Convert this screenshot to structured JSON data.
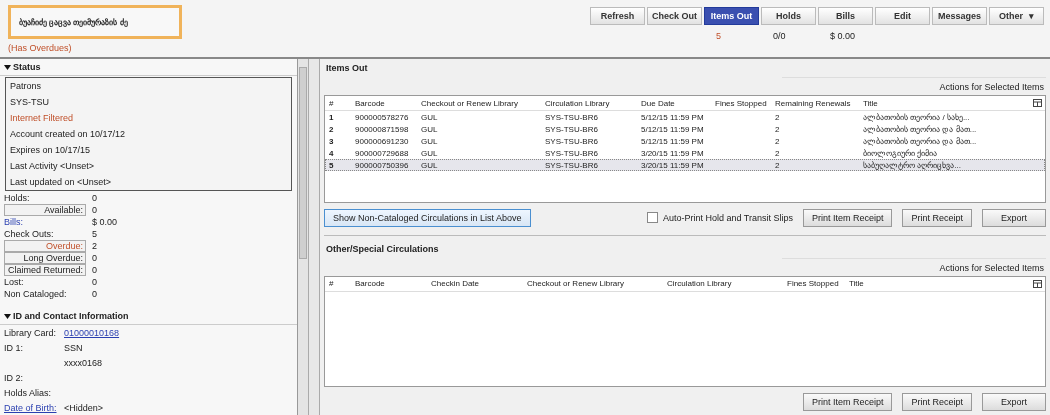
{
  "patron": {
    "name": "ბუაჩიძე ცაცვა თეიმურაზის ძე",
    "alert": "(Has Overdues)"
  },
  "tabs": [
    {
      "label": "Refresh",
      "selected": false
    },
    {
      "label": "Check Out",
      "selected": false
    },
    {
      "label": "Items Out",
      "selected": true,
      "count": "5",
      "count_alert": true
    },
    {
      "label": "Holds",
      "selected": false,
      "count": "0/0",
      "count_alert": false
    },
    {
      "label": "Bills",
      "selected": false,
      "count": "$ 0.00",
      "count_alert": false
    },
    {
      "label": "Edit",
      "selected": false
    },
    {
      "label": "Messages",
      "selected": false
    },
    {
      "label": "Other",
      "selected": false,
      "caret": "▾"
    }
  ],
  "status": {
    "title": "Status",
    "expanded": true,
    "items": [
      {
        "text": "Patrons",
        "alert": false
      },
      {
        "text": "SYS-TSU",
        "alert": false
      },
      {
        "text": "Internet Filtered",
        "alert": true
      },
      {
        "text": "Account created on 10/17/12",
        "alert": false
      },
      {
        "text": "Expires on 10/17/15",
        "alert": false
      },
      {
        "text": "Last Activity <Unset>",
        "alert": false
      },
      {
        "text": "Last updated on <Unset>",
        "alert": false
      }
    ],
    "stats": [
      {
        "label": "Holds:",
        "value": "0",
        "kind": "plain",
        "alert": false
      },
      {
        "label": "Available:",
        "value": "0",
        "kind": "boxed",
        "alert": false
      },
      {
        "label": "Bills:",
        "value": "$ 0.00",
        "kind": "link",
        "alert": false
      },
      {
        "label": "Check Outs:",
        "value": "5",
        "kind": "plain",
        "alert": false
      },
      {
        "label": "Overdue:",
        "value": "2",
        "kind": "boxed",
        "alert": true
      },
      {
        "label": "Long Overdue:",
        "value": "0",
        "kind": "boxed",
        "alert": false
      },
      {
        "label": "Claimed Returned:",
        "value": "0",
        "kind": "boxed",
        "alert": false
      },
      {
        "label": "Lost:",
        "value": "0",
        "kind": "plain",
        "alert": false
      },
      {
        "label": "Non Cataloged:",
        "value": "0",
        "kind": "plain",
        "alert": false
      }
    ]
  },
  "contact": {
    "title": "ID and Contact Information",
    "expanded": true,
    "rows": [
      {
        "label": "Library Card:",
        "value": "01000010168",
        "kind": "value_link"
      },
      {
        "label": "ID 1:",
        "value": "SSN",
        "kind": "plain"
      },
      {
        "value": "xxxx0168",
        "kind": "plain"
      },
      {
        "label": "ID 2:",
        "kind": "plain"
      },
      {
        "label": "Holds Alias:",
        "kind": "plain"
      },
      {
        "label": "Date of Birth:",
        "value": "<Hidden>",
        "kind": "label_link"
      }
    ]
  },
  "items_out": {
    "title": "Items Out",
    "actions": "Actions for Selected Items",
    "columns": [
      "#",
      "Barcode",
      "Checkout or Renew Library",
      "Circulation Library",
      "Due Date",
      "Fines Stopped",
      "Remaining Renewals",
      "Title"
    ],
    "rows": [
      {
        "selected": false,
        "cells": [
          "1",
          "900000578276",
          "GUL",
          "SYS-TSU-BR6",
          "5/12/15 11:59 PM",
          "",
          "2",
          "ალბათობის თეორია / სახე..."
        ]
      },
      {
        "selected": false,
        "cells": [
          "2",
          "900000871598",
          "GUL",
          "SYS-TSU-BR6",
          "5/12/15 11:59 PM",
          "",
          "2",
          "ალბათობის თეორია და მათ..."
        ]
      },
      {
        "selected": false,
        "cells": [
          "3",
          "900000691230",
          "GUL",
          "SYS-TSU-BR6",
          "5/12/15 11:59 PM",
          "",
          "2",
          "ალბათობის თეორია და მათ..."
        ]
      },
      {
        "selected": false,
        "cells": [
          "4",
          "900000729688",
          "GUL",
          "SYS-TSU-BR6",
          "3/20/15 11:59 PM",
          "",
          "2",
          "ბიოლოგიური ქიმია"
        ]
      },
      {
        "selected": true,
        "cells": [
          "5",
          "900000750396",
          "GUL",
          "SYS-TSU-BR6",
          "3/20/15 11:59 PM",
          "",
          "2",
          "საბუღალტრო აღრიცხვა..."
        ]
      }
    ],
    "show_button": "Show Non-Cataloged Circulations in List Above",
    "auto_print": {
      "label": "Auto-Print Hold and Transit Slips",
      "checked": false
    },
    "buttons": [
      "Print Item Receipt",
      "Print Receipt",
      "Export"
    ]
  },
  "other": {
    "title": "Other/Special Circulations",
    "actions": "Actions for Selected Items",
    "columns": [
      "#",
      "Barcode",
      "Checkin Date",
      "Checkout or Renew Library",
      "Circulation Library",
      "Fines Stopped",
      "Title"
    ],
    "buttons": [
      "Print Item Receipt",
      "Print Receipt",
      "Export"
    ]
  }
}
